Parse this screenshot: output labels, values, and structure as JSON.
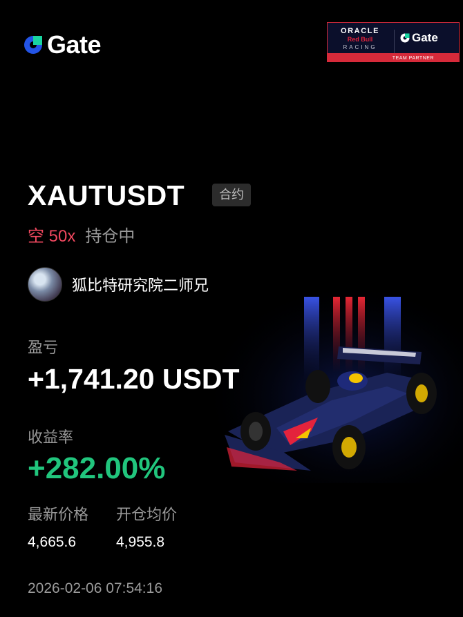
{
  "brand": {
    "name": "Gate",
    "accent": "#2354e6"
  },
  "partner_badge": {
    "line1": "ORACLE",
    "line2": "Red Bull",
    "line3": "RACING",
    "gate": "Gate",
    "footer": "TEAM PARTNER"
  },
  "position": {
    "symbol": "XAUTUSDT",
    "type_tag": "合约",
    "side": "空 50x",
    "status": "持仓中"
  },
  "user": {
    "name": "狐比特研究院二师兄"
  },
  "pnl": {
    "label": "盈亏",
    "value": "+1,741.20 USDT"
  },
  "roi": {
    "label": "收益率",
    "value": "+282.00%"
  },
  "prices": {
    "latest_label": "最新价格",
    "latest_value": "4,665.6",
    "entry_label": "开仓均价",
    "entry_value": "4,955.8"
  },
  "timestamp": "2026-02-06 07:54:16",
  "colors": {
    "positive": "#21c57d",
    "short": "#f0485f",
    "muted": "#9a9a9a"
  }
}
